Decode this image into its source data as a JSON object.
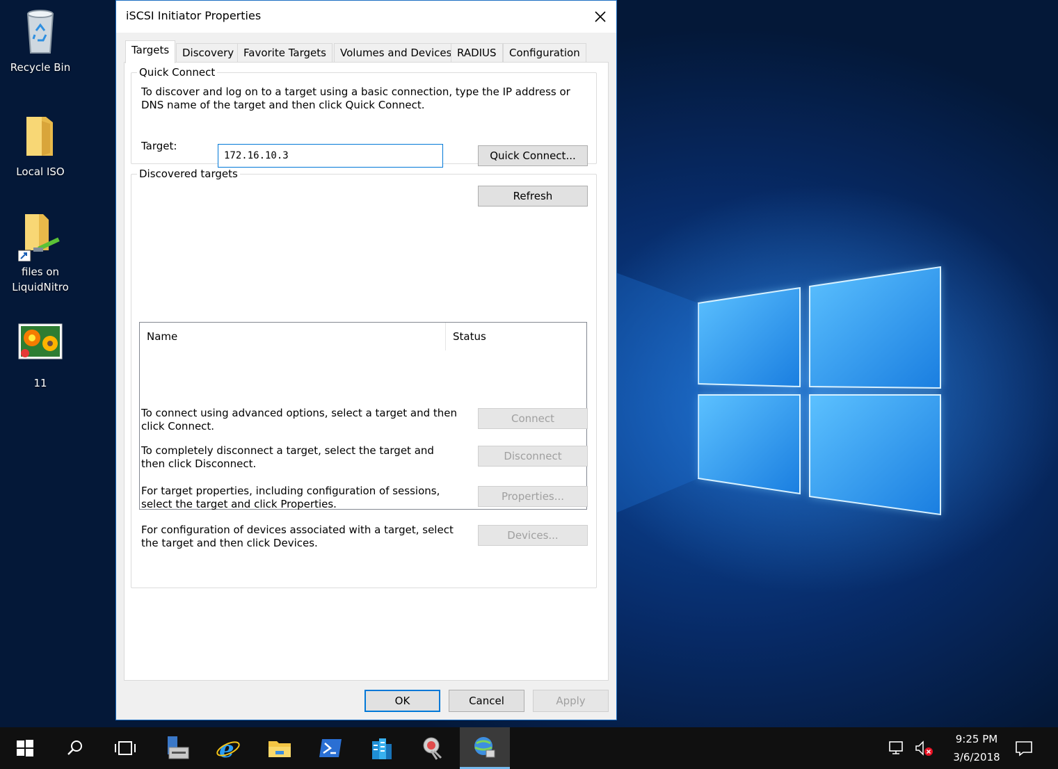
{
  "desktop": {
    "icons": [
      {
        "label": "Recycle Bin",
        "icon": "recycle-bin-icon"
      },
      {
        "label": "Local ISO",
        "icon": "folder-icon"
      },
      {
        "label": "files on\nLiquidNitro",
        "icon": "network-folder-shortcut-icon"
      },
      {
        "label": "11",
        "icon": "image-file-icon"
      }
    ]
  },
  "dialog": {
    "title": "iSCSI Initiator Properties",
    "close_glyph": "✕",
    "tabs": [
      {
        "label": "Targets",
        "active": true
      },
      {
        "label": "Discovery"
      },
      {
        "label": "Favorite Targets"
      },
      {
        "label": "Volumes and Devices"
      },
      {
        "label": "RADIUS"
      },
      {
        "label": "Configuration"
      }
    ],
    "quick_connect": {
      "group_label": "Quick Connect",
      "description": "To discover and log on to a target using a basic connection, type the IP address or DNS name of the target and then click Quick Connect.",
      "target_label": "Target:",
      "target_value": "172.16.10.3",
      "button_label": "Quick Connect..."
    },
    "discovered": {
      "group_label": "Discovered targets",
      "refresh_label": "Refresh",
      "columns": [
        "Name",
        "Status"
      ],
      "rows": []
    },
    "actions": [
      {
        "text": "To connect using advanced options, select a target and then click Connect.",
        "button": "Connect"
      },
      {
        "text": "To completely disconnect a target, select the target and then click Disconnect.",
        "button": "Disconnect"
      },
      {
        "text": "For target properties, including configuration of sessions, select the target and click Properties.",
        "button": "Properties..."
      },
      {
        "text": "For configuration of devices associated with a target, select the target and then click Devices.",
        "button": "Devices..."
      }
    ],
    "footer": {
      "ok": "OK",
      "cancel": "Cancel",
      "apply": "Apply"
    }
  },
  "taskbar": {
    "items": [
      "start-icon",
      "search-icon",
      "task-view-icon",
      "server-manager-icon",
      "internet-explorer-icon",
      "file-explorer-icon",
      "powershell-icon",
      "server-tools-icon",
      "network-tools-icon",
      "iscsi-initiator-icon"
    ],
    "active_item": "iscsi-initiator-icon",
    "time": "9:25 PM",
    "date": "3/6/2018"
  },
  "colors": {
    "accent": "#0078d7",
    "taskbar": "#101010",
    "dialog_bg": "#f0f0f0"
  }
}
